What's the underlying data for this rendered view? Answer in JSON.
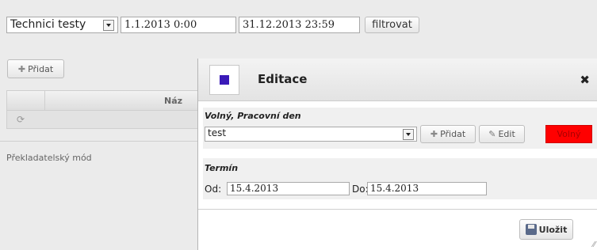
{
  "filter": {
    "category_value": "Technici testy",
    "date_from": "1.1.2013 0:00",
    "date_to": "31.12.2013 23:59",
    "filter_button": "filtrovat"
  },
  "main": {
    "add_button": "Přidat",
    "grid_header_col": "Náz",
    "row_icon": "refresh-icon",
    "translator_mode": "Překladatelský mód"
  },
  "dialog": {
    "title": "Editace",
    "icon_color": "#3a1ab8",
    "section1_title": "Volný, Pracovní den",
    "select_value": "test",
    "add_button": "Přidat",
    "edit_button": "Edit",
    "status_badge": "Volný",
    "status_color": "#ff0000",
    "section2_title": "Termín",
    "from_label": "Od:",
    "from_value": "15.4.2013",
    "to_label": "Do:",
    "to_value": "15.4.2013",
    "save_button": "Uložit"
  }
}
